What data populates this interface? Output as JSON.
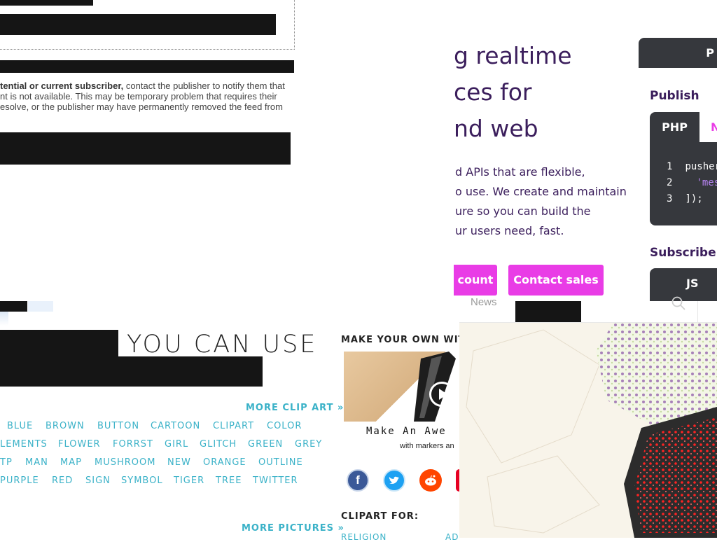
{
  "feed": {
    "warning_bold": "tential or current subscriber,",
    "warning_rest": " contact the publisher to notify them that",
    "warning_line2": "nt is not available. This may be temporary problem that requires their",
    "warning_line3": "esolve, or the publisher may have permanently removed the feed from"
  },
  "pusher": {
    "hero_lines": [
      "g realtime",
      "ces for",
      "nd web"
    ],
    "description_lines": [
      "d APIs that are flexible,",
      "o use. We create and maintain",
      "ure so you can build the",
      "ur users need, fast."
    ],
    "account_button": "count",
    "contact_button": "Contact sales",
    "top_tab": "P",
    "publish_heading": "Publish",
    "subscribe_heading": "Subscribe",
    "publish_tabs": [
      "PHP",
      "N"
    ],
    "subscribe_tab": "JS",
    "code_lines": [
      {
        "num": "1",
        "code": "pusher"
      },
      {
        "num": "2",
        "code": "'mes"
      },
      {
        "num": "3",
        "code": "]);"
      }
    ],
    "nav_news": "News"
  },
  "clipart": {
    "heading": "YOU CAN USE",
    "more_clip_art": "MORE CLIP ART »",
    "more_pictures": "MORE PICTURES »",
    "make_your_own": "MAKE YOUR OWN WITH",
    "video_title": "Make An Awe",
    "video_subtitle": "with markers an",
    "clipart_for": "CLIPART FOR:",
    "clipart_for_items": [
      "RELIGION",
      "AD"
    ],
    "tag_rows": [
      [
        "BLUE",
        "BROWN",
        "BUTTON",
        "CARTOON",
        "CLIPART",
        "COLOR"
      ],
      [
        "LEMENTS",
        "FLOWER",
        "FORRST",
        "GIRL",
        "GLITCH",
        "GREEN",
        "GREY"
      ],
      [
        "TP",
        "MAN",
        "MAP",
        "MUSHROOM",
        "NEW",
        "ORANGE",
        "OUTLINE"
      ],
      [
        "PURPLE",
        "RED",
        "SIGN",
        "SYMBOL",
        "TIGER",
        "TREE",
        "TWITTER"
      ]
    ],
    "social_icons": [
      "facebook-icon",
      "twitter-icon",
      "reddit-icon",
      "pinterest-icon"
    ]
  },
  "colors": {
    "pusher_purple": "#3b1e5c",
    "pusher_magenta": "#e93ce6",
    "code_bg": "#36383d",
    "clipart_teal": "#3bb2c8"
  }
}
